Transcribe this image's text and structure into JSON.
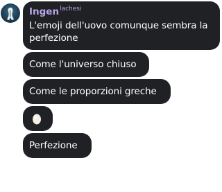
{
  "chat": {
    "sender": {
      "name": "Ingen",
      "tag": "lachesi",
      "name_color": "#b9a3e8"
    },
    "bubble_color": "#202124",
    "messages": [
      {
        "text": "L'emoji dell'uovo comunque sembra la perfezione"
      },
      {
        "text": "Come l'universo chiuso"
      },
      {
        "text": "Come le proporzioni greche"
      },
      {
        "icon": "egg-emoji"
      },
      {
        "text": "Perfezione"
      }
    ]
  }
}
